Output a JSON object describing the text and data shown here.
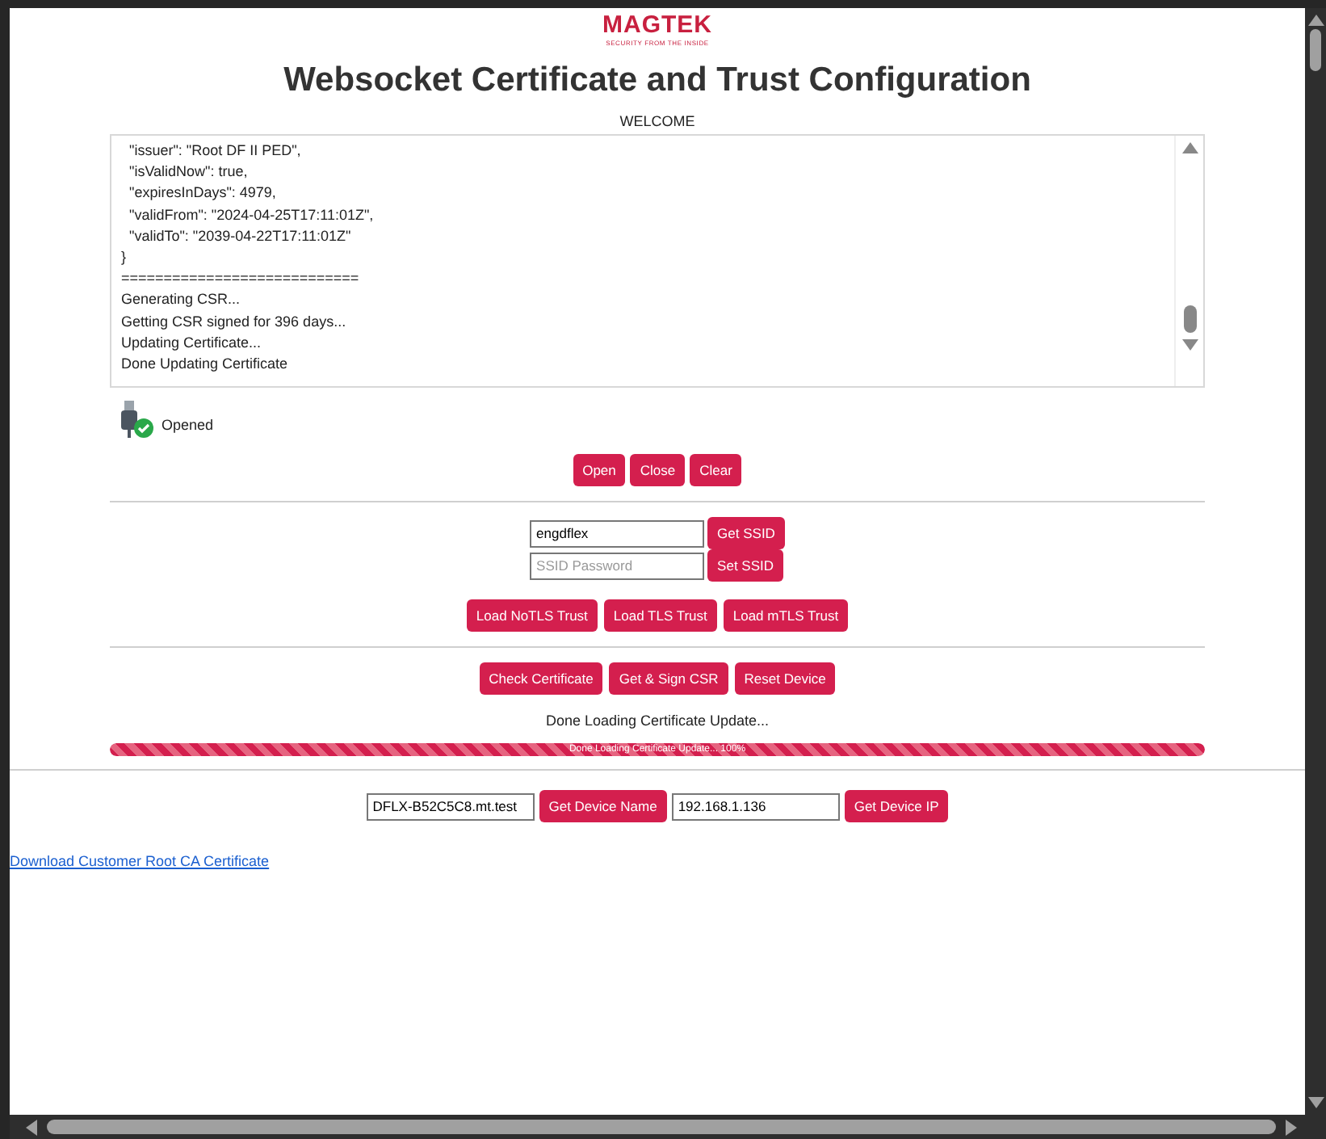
{
  "logo": {
    "brand": "MAGTEK",
    "tagline": "SECURITY FROM THE INSIDE"
  },
  "title": "Websocket Certificate and Trust Configuration",
  "log": {
    "label": "WELCOME",
    "lines": [
      "  \"issuer\": \"Root DF II PED\",",
      "  \"isValidNow\": true,",
      "  \"expiresInDays\": 4979,",
      "  \"validFrom\": \"2024-04-25T17:11:01Z\",",
      "  \"validTo\": \"2039-04-22T17:11:01Z\"",
      "}",
      "============================",
      "Generating CSR...",
      "Getting CSR signed for 396 days...",
      "Updating Certificate...",
      "Done Updating Certificate"
    ]
  },
  "device_status": {
    "label": "Opened",
    "connected": true
  },
  "connection_buttons": [
    "Open",
    "Close",
    "Clear"
  ],
  "wifi": {
    "ssid_value": "engdflex",
    "get_button": "Get SSID",
    "password_placeholder": "SSID Password",
    "set_button": "Set SSID"
  },
  "trust_buttons": [
    "Load NoTLS Trust",
    "Load TLS Trust",
    "Load mTLS Trust"
  ],
  "certificate_buttons": [
    "Check Certificate",
    "Get & Sign CSR",
    "Reset Device"
  ],
  "status_message": "Done Loading Certificate Update...",
  "progress": {
    "level": 1.0,
    "label": "Done Loading Certificate Update... 100%"
  },
  "device_name": {
    "value": "DFLX-B52C5C8.mt.test",
    "button": "Get Device Name"
  },
  "device_ip": {
    "value": "192.168.1.136",
    "button": "Get Device IP"
  },
  "download_link": "Download Customer Root CA Certificate"
}
